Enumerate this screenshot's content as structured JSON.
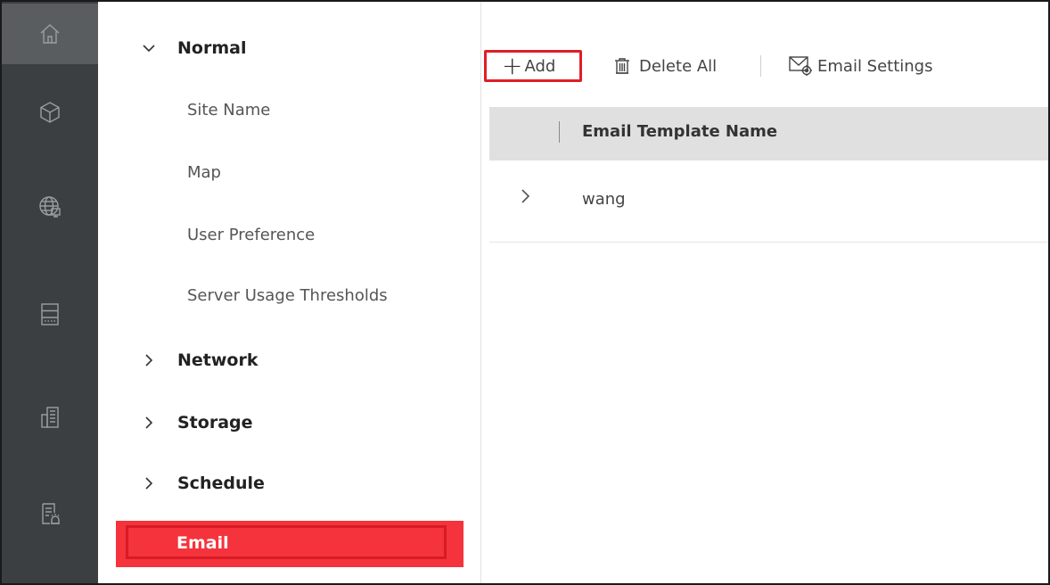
{
  "rail": {
    "items": [
      {
        "icon": "home-icon",
        "active": true
      },
      {
        "icon": "cube-icon"
      },
      {
        "icon": "globe-network-icon"
      },
      {
        "icon": "server-icon"
      },
      {
        "icon": "building-icon"
      },
      {
        "icon": "log-alarm-icon"
      }
    ]
  },
  "menu": {
    "groups": [
      {
        "label": "Normal",
        "expanded": true,
        "children": [
          "Site Name",
          "Map",
          "User Preference",
          "Server Usage Thresholds"
        ]
      },
      {
        "label": "Network",
        "expanded": false
      },
      {
        "label": "Storage",
        "expanded": false
      },
      {
        "label": "Schedule",
        "expanded": false
      },
      {
        "label": "Email",
        "selected": true
      }
    ]
  },
  "toolbar": {
    "add_label": "Add",
    "delete_all_label": "Delete All",
    "email_settings_label": "Email Settings"
  },
  "table": {
    "columns": [
      "Email Template Name"
    ],
    "rows": [
      {
        "name": "wang"
      }
    ]
  },
  "colors": {
    "rail_bg": "#3c3f42",
    "highlight_red": "#f4333c",
    "header_bg": "#e0e0e0"
  }
}
